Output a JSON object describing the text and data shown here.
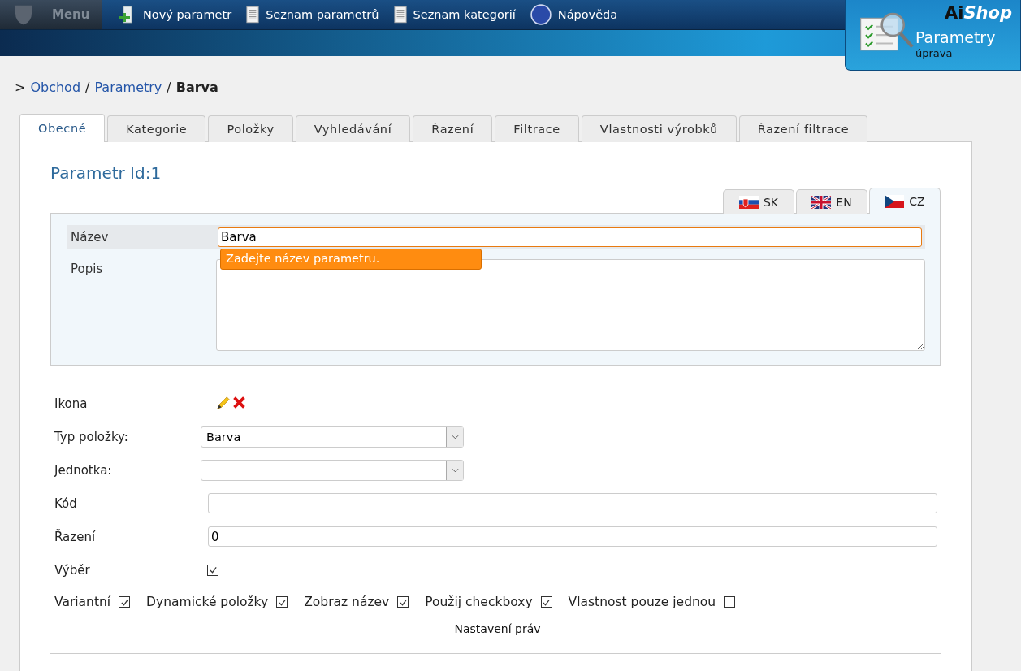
{
  "menu": {
    "label": "Menu"
  },
  "nav": [
    {
      "kind": "add",
      "label": "Nový parametr"
    },
    {
      "kind": "list",
      "label": "Seznam parametrů"
    },
    {
      "kind": "list",
      "label": "Seznam kategorií"
    },
    {
      "kind": "help",
      "label": "Nápověda"
    }
  ],
  "logo": {
    "brand_prefix": "Ai",
    "brand_suffix": "Shop",
    "title": "Parametry",
    "subtitle": "úprava"
  },
  "breadcrumb": {
    "prefix": ">",
    "separators": [
      "/",
      "/"
    ],
    "items": [
      {
        "label": "Obchod",
        "link": true
      },
      {
        "label": "Parametry",
        "link": true
      },
      {
        "label": "Barva",
        "link": false
      }
    ]
  },
  "tabs": [
    {
      "label": "Obecné",
      "selected": true
    },
    {
      "label": "Kategorie",
      "selected": false
    },
    {
      "label": "Položky",
      "selected": false
    },
    {
      "label": "Vyhledávání",
      "selected": false
    },
    {
      "label": "Řazení",
      "selected": false
    },
    {
      "label": "Filtrace",
      "selected": false
    },
    {
      "label": "Vlastnosti výrobků",
      "selected": false
    },
    {
      "label": "Řazení filtrace",
      "selected": false
    }
  ],
  "heading": "Parametr Id:1",
  "languages": [
    {
      "kind": "sk",
      "label": "SK",
      "selected": false
    },
    {
      "kind": "gb",
      "label": "EN",
      "selected": false
    },
    {
      "kind": "cz",
      "label": "CZ",
      "selected": true
    }
  ],
  "name_field": {
    "label": "Název",
    "value": "Barva",
    "tooltip": "Zadejte název parametru."
  },
  "description_field": {
    "label": "Popis"
  },
  "fields": [
    {
      "kind": "icon",
      "label": "Ikona"
    },
    {
      "kind": "select",
      "label": "Typ položky:",
      "value": "Barva"
    },
    {
      "kind": "select",
      "label": "Jednotka:"
    },
    {
      "kind": "input",
      "label": "Kód"
    },
    {
      "kind": "input",
      "label": "Řazení",
      "value": "0"
    },
    {
      "kind": "checkbox",
      "label": "Výběr",
      "checked": true
    }
  ],
  "options": [
    {
      "label": "Variantní",
      "checked": true
    },
    {
      "label": "Dynamické položky",
      "checked": true
    },
    {
      "label": "Zobraz název",
      "checked": true
    },
    {
      "label": "Použij checkboxy",
      "checked": true
    },
    {
      "label": "Vlastnost pouze jednou",
      "checked": false
    }
  ],
  "rights_link": "Nastavení práv"
}
